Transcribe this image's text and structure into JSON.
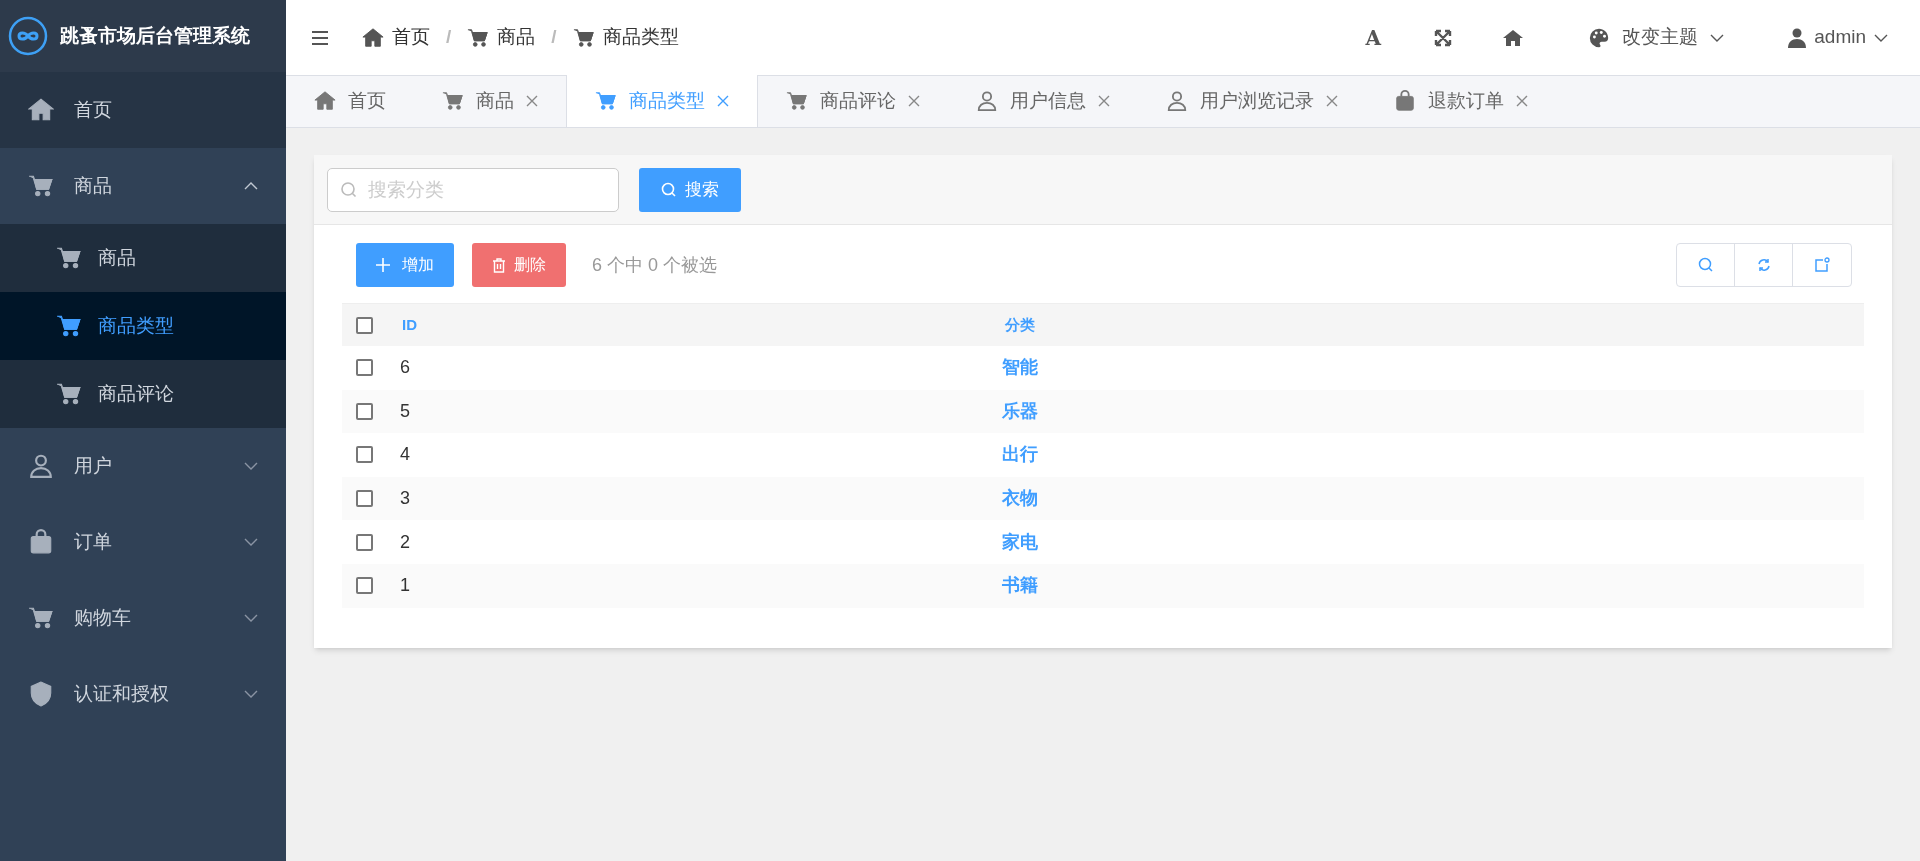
{
  "app": {
    "title": "跳蚤市场后台管理系统"
  },
  "sidebar": {
    "items": [
      {
        "label": "首页",
        "kind": "home",
        "selected": false
      },
      {
        "label": "商品",
        "kind": "cart",
        "expanded": true,
        "selected": false,
        "children": [
          {
            "label": "商品",
            "kind": "cart",
            "selected": false
          },
          {
            "label": "商品类型",
            "kind": "cart",
            "selected": true
          },
          {
            "label": "商品评论",
            "kind": "cart",
            "selected": false
          }
        ]
      },
      {
        "label": "用户",
        "kind": "user",
        "expanded": false,
        "selected": false
      },
      {
        "label": "订单",
        "kind": "bag",
        "expanded": false,
        "selected": false
      },
      {
        "label": "购物车",
        "kind": "cart",
        "expanded": false,
        "selected": false
      },
      {
        "label": "认证和授权",
        "kind": "shield",
        "expanded": false,
        "selected": false
      }
    ]
  },
  "breadcrumb": [
    {
      "label": "首页",
      "kind": "home"
    },
    {
      "separator": "/",
      "label": "商品",
      "kind": "cart"
    },
    {
      "separator": "/",
      "label": "商品类型",
      "kind": "cart"
    }
  ],
  "header_actions": {
    "font_size": "A",
    "theme": "改变主题",
    "user": "admin"
  },
  "tabs": [
    {
      "label": "首页",
      "kind": "home",
      "closable": false,
      "selected": false
    },
    {
      "label": "商品",
      "kind": "cart",
      "closable": true,
      "selected": false
    },
    {
      "label": "商品类型",
      "kind": "cart",
      "closable": true,
      "selected": true
    },
    {
      "label": "商品评论",
      "kind": "cart",
      "closable": true,
      "selected": false
    },
    {
      "label": "用户信息",
      "kind": "user",
      "closable": true,
      "selected": false
    },
    {
      "label": "用户浏览记录",
      "kind": "user",
      "closable": true,
      "selected": false
    },
    {
      "label": "退款订单",
      "kind": "bag",
      "closable": true,
      "selected": false
    }
  ],
  "search": {
    "placeholder": "搜索分类",
    "button": "搜索"
  },
  "toolbar": {
    "add": "增加",
    "delete": "删除",
    "selection_info": "6 个中 0 个被选"
  },
  "table": {
    "select_all_checked": false,
    "columns": [
      "ID",
      "分类"
    ],
    "rows": [
      {
        "id": "6",
        "category": "智能",
        "checked": false
      },
      {
        "id": "5",
        "category": "乐器",
        "checked": false
      },
      {
        "id": "4",
        "category": "出行",
        "checked": false
      },
      {
        "id": "3",
        "category": "衣物",
        "checked": false
      },
      {
        "id": "2",
        "category": "家电",
        "checked": false
      },
      {
        "id": "1",
        "category": "书籍",
        "checked": false
      }
    ]
  }
}
